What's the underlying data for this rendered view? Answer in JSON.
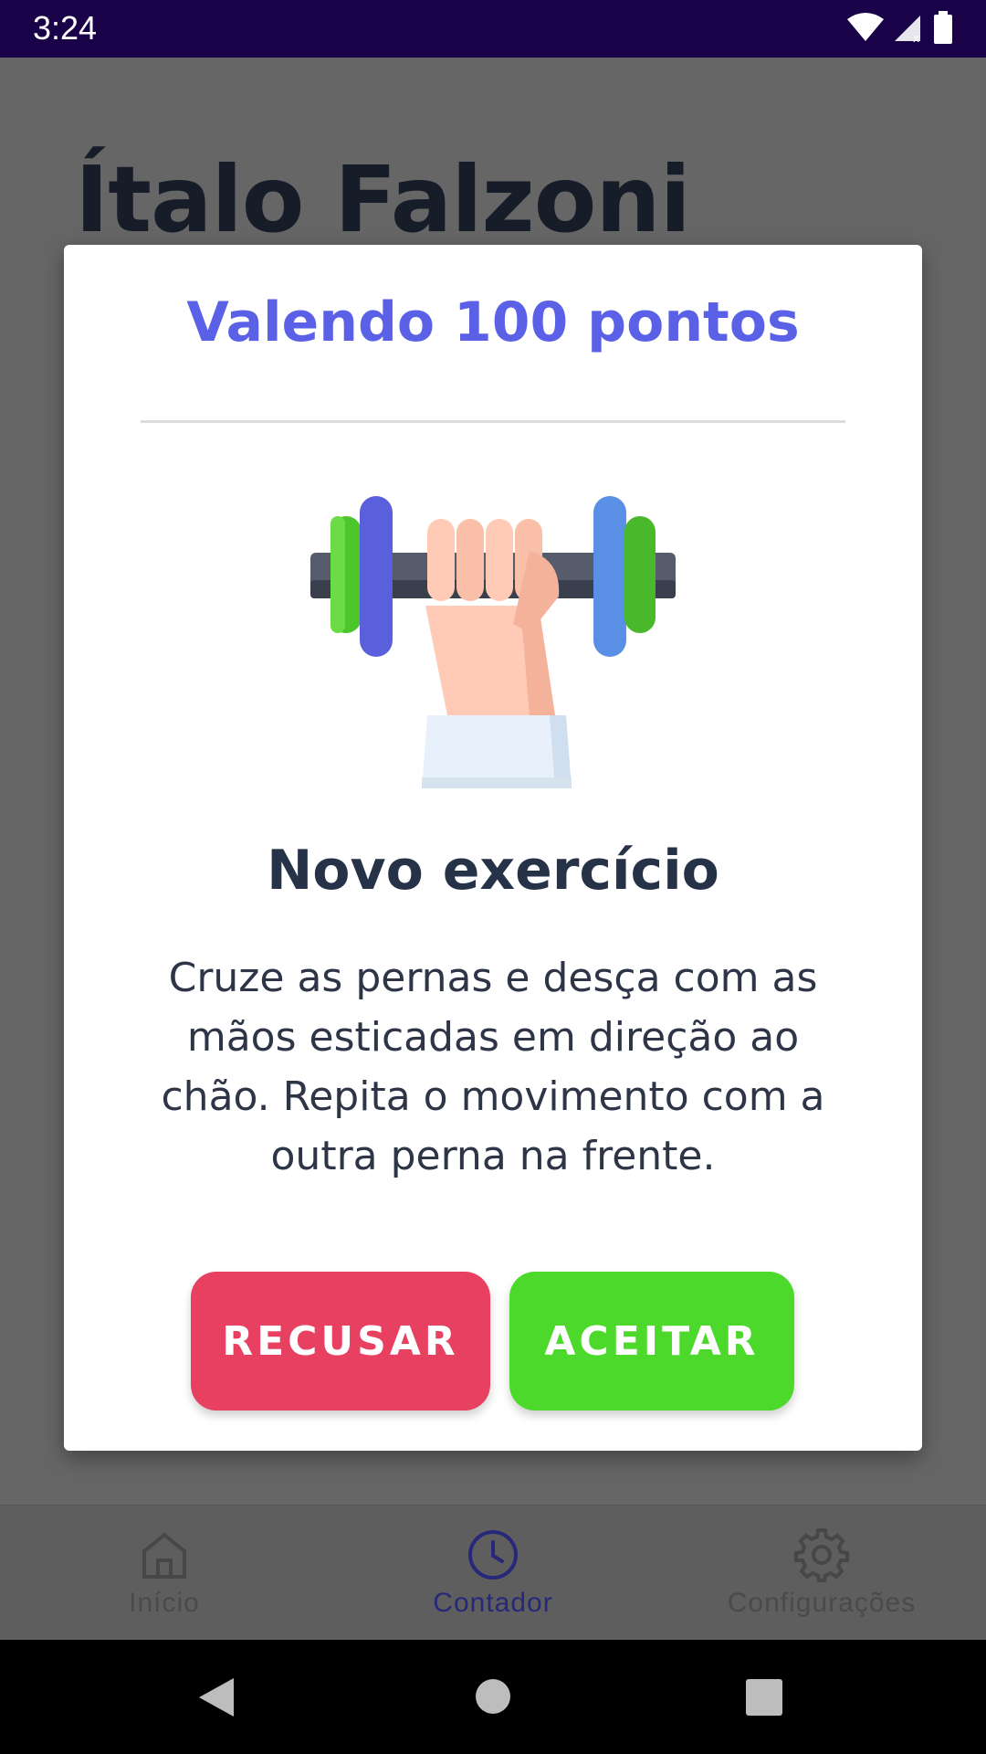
{
  "status_bar": {
    "time": "3:24"
  },
  "background": {
    "user_name": "Ítalo Falzoni"
  },
  "modal": {
    "points_label": "Valendo 100 pontos",
    "title": "Novo exercício",
    "description": "Cruze as pernas e desça com as mãos esticadas em direção ao chão. Repita o movimento com a outra perna na frente.",
    "refuse_label": "RECUSAR",
    "accept_label": "ACEITAR",
    "illustration_icon": "dumbbell-hand-icon"
  },
  "bottom_nav": {
    "items": [
      {
        "label": "Início",
        "icon": "home-icon",
        "active": false
      },
      {
        "label": "Contador",
        "icon": "clock-icon",
        "active": true
      },
      {
        "label": "Configurações",
        "icon": "gear-icon",
        "active": false
      }
    ]
  },
  "colors": {
    "accent": "#5b61e6",
    "refuse": "#e84060",
    "accept": "#4cd92b",
    "status_bar": "#1a0248"
  }
}
